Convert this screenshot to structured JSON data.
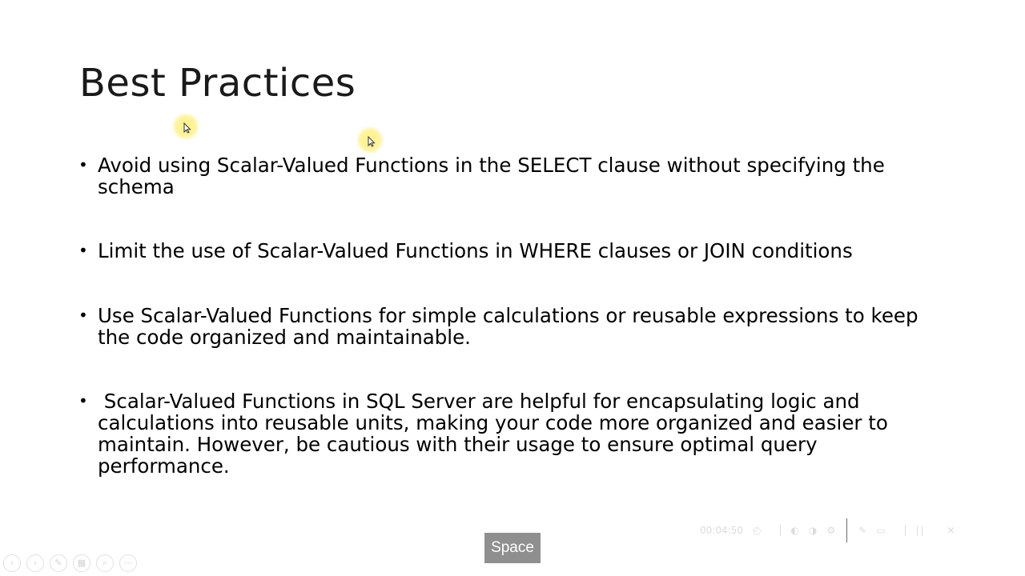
{
  "slide": {
    "title": "Best Practices",
    "bullets": [
      {
        "marker": "•",
        "text": "Avoid using Scalar-Valued Functions in the SELECT clause without specifying the schema"
      },
      {
        "marker": "•",
        "text": "Limit the use of Scalar-Valued Functions in WHERE clauses or JOIN conditions"
      },
      {
        "marker": "•",
        "text": "Use Scalar-Valued Functions for simple calculations or reusable expressions to keep the code organized and maintainable."
      },
      {
        "marker": "•",
        "text": " Scalar-Valued Functions in SQL Server are helpful for encapsulating logic and calculations into reusable units, making your code more organized and easier to maintain. However, be cautious with their usage to ensure optimal query performance."
      }
    ]
  },
  "overlay": {
    "key_badge": "Space",
    "highlight_color": "#fff07a",
    "key_badge_color": "#8f8f8f"
  },
  "presenter_toolbar": {
    "timer": "00:04:50",
    "icons": [
      "pause-icon",
      "microphone-icon",
      "speaker-icon",
      "settings-icon",
      "pen-icon",
      "subtitles-icon",
      "close-icon"
    ]
  },
  "slideshow_nav": {
    "buttons": [
      {
        "name": "previous-slide-icon",
        "glyph": "‹"
      },
      {
        "name": "next-slide-icon",
        "glyph": "›"
      },
      {
        "name": "pen-tool-icon",
        "glyph": "✎"
      },
      {
        "name": "all-slides-icon",
        "glyph": "▦"
      },
      {
        "name": "zoom-icon",
        "glyph": "⌕"
      },
      {
        "name": "more-options-icon",
        "glyph": "⋯"
      }
    ]
  }
}
